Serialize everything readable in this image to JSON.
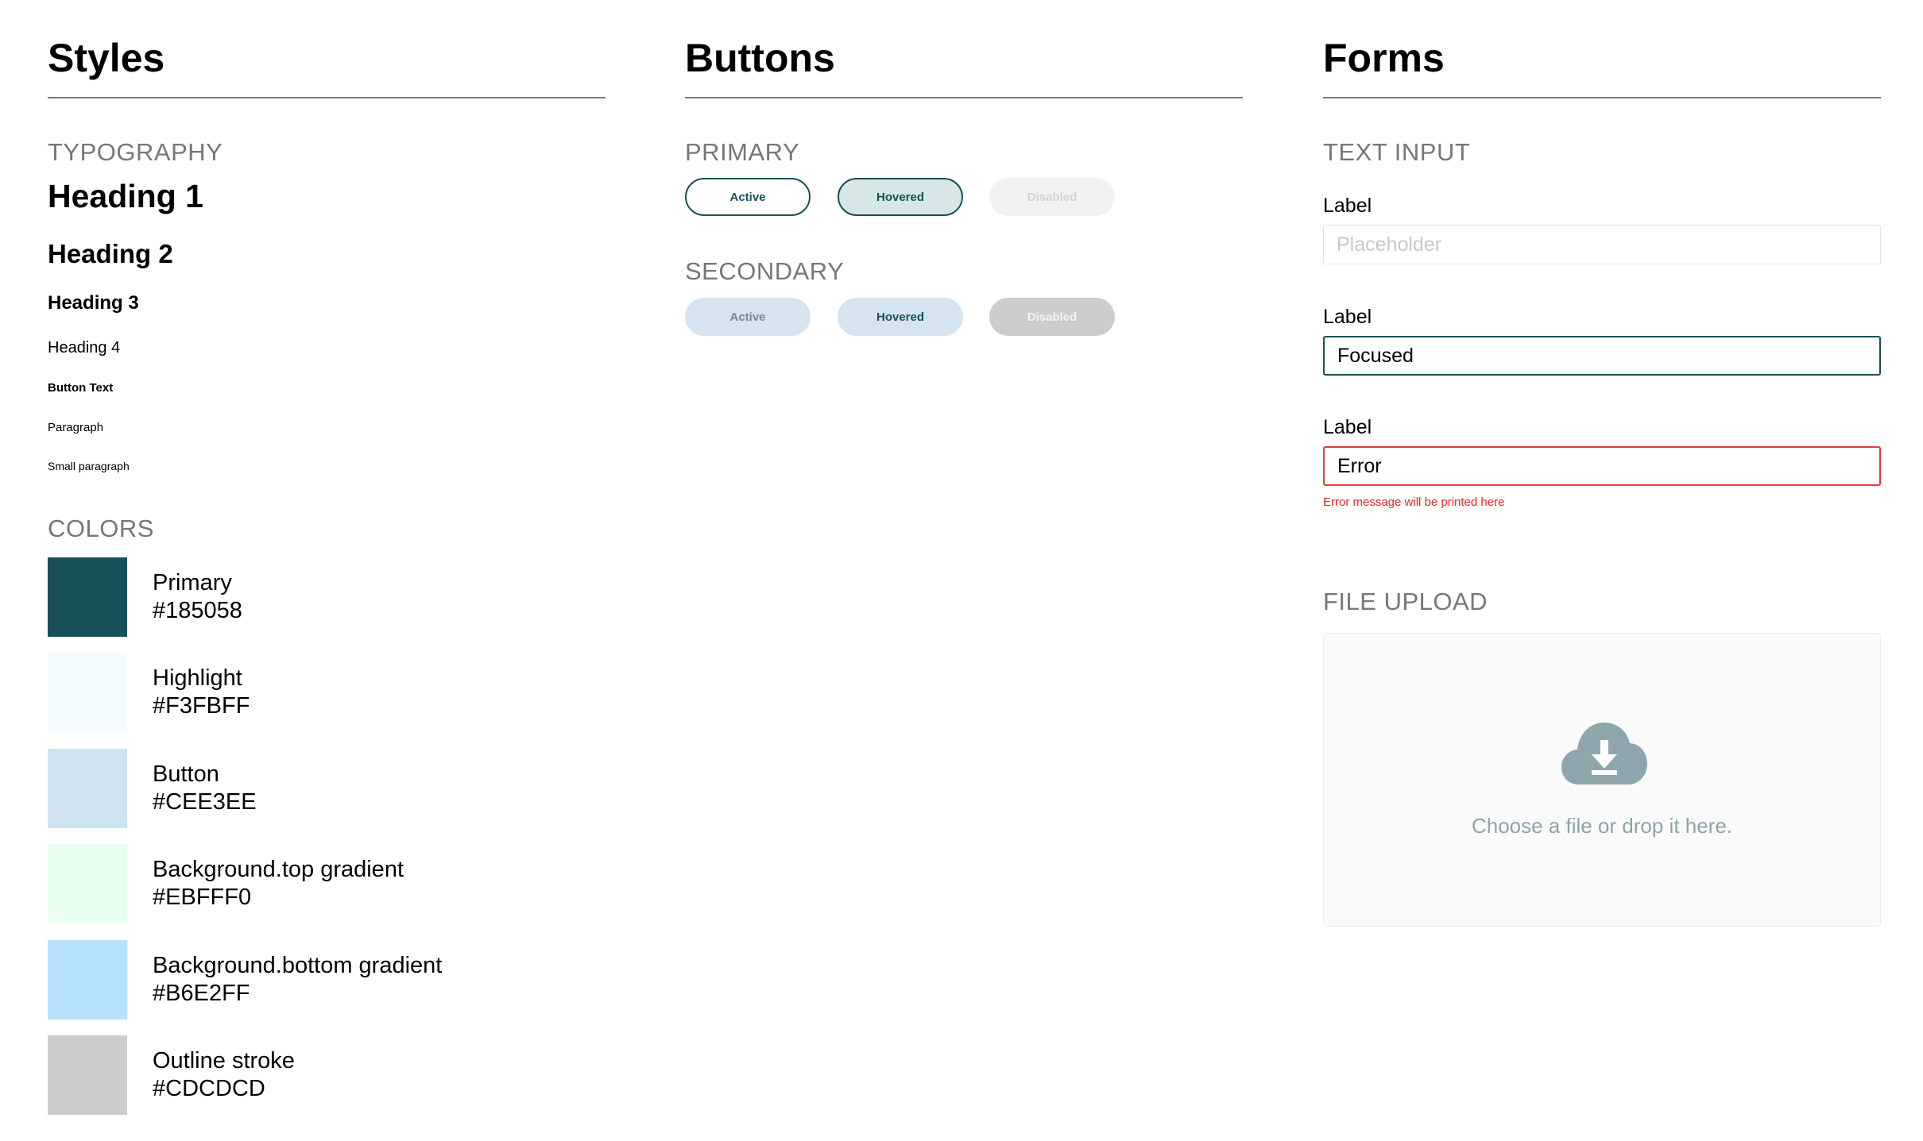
{
  "styles": {
    "title": "Styles",
    "typography": {
      "label": "TYPOGRAPHY",
      "heading1": "Heading 1",
      "heading2": "Heading 2",
      "heading3": "Heading 3",
      "heading4": "Heading 4",
      "button_text": "Button Text",
      "paragraph": "Paragraph",
      "small_paragraph": "Small paragraph"
    },
    "colors": {
      "label": "COLORS",
      "items": [
        {
          "name": "Primary",
          "hex": "#185058"
        },
        {
          "name": "Highlight",
          "hex": "#F3FBFF"
        },
        {
          "name": "Button",
          "hex": "#CEE3EE"
        },
        {
          "name": "Background.top gradient",
          "hex": "#EBFFF0"
        },
        {
          "name": "Background.bottom gradient",
          "hex": "#B6E2FF"
        },
        {
          "name": "Outline stroke",
          "hex": "#CDCDCD"
        }
      ]
    }
  },
  "buttons": {
    "title": "Buttons",
    "primary": {
      "label": "PRIMARY",
      "active": "Active",
      "hovered": "Hovered",
      "disabled": "Disabled"
    },
    "secondary": {
      "label": "SECONDARY",
      "active": "Active",
      "hovered": "Hovered",
      "disabled": "Disabled"
    }
  },
  "forms": {
    "title": "Forms",
    "text_input": {
      "label": "TEXT INPUT",
      "fields": [
        {
          "label": "Label",
          "value": "",
          "placeholder": "Placeholder"
        },
        {
          "label": "Label",
          "value": "Focused"
        },
        {
          "label": "Label",
          "value": "Error",
          "error": "Error message will be printed here"
        }
      ]
    },
    "file_upload": {
      "label": "FILE UPLOAD",
      "icon": "cloud-download-icon",
      "prompt": "Choose a file or drop it here."
    }
  }
}
